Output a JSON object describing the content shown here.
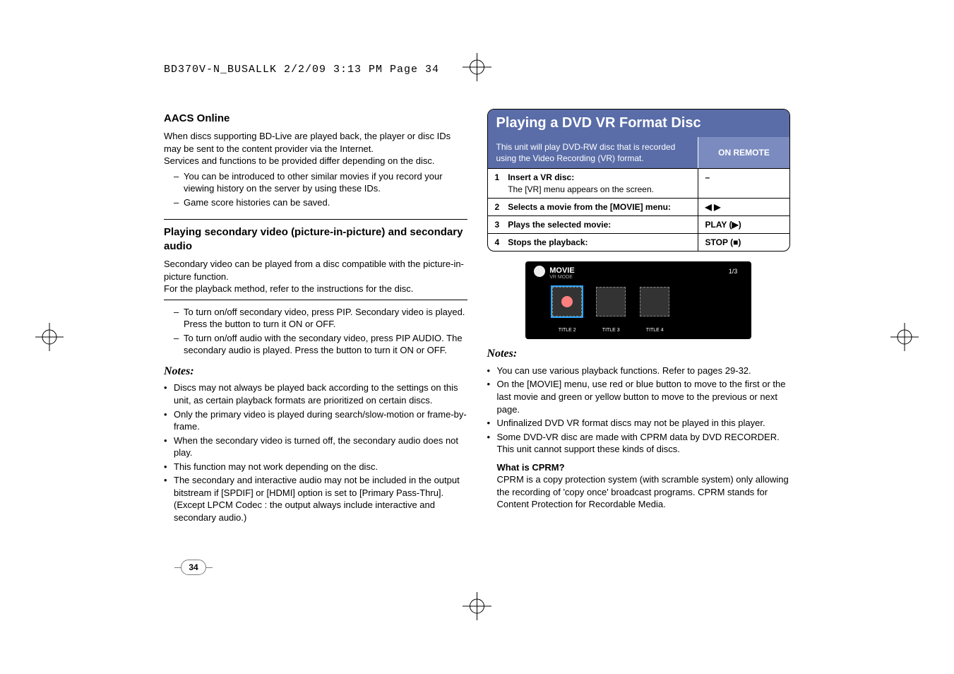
{
  "runhead": "BD370V-N_BUSALLK  2/2/09  3:13 PM  Page 34",
  "page_number": "34",
  "left": {
    "h_aacs": "AACS Online",
    "aacs_p1": "When discs supporting BD-Live are played back, the player or disc IDs may be sent to the content provider via the Internet.",
    "aacs_p2": "Services and functions to be provided differ depending on the disc.",
    "aacs_li1": "You can be introduced to other similar movies if you record your viewing history on the server by using these IDs.",
    "aacs_li2": "Game score histories can be saved.",
    "h_pip": "Playing secondary video (picture-in-picture) and secondary audio",
    "pip_p1": "Secondary video can be played from a disc compatible with the picture-in-picture function.",
    "pip_p2": "For the playback method, refer to the instructions for the disc.",
    "pip_li1": "To turn on/off secondary video, press PIP. Secondary video is played. Press the button to turn it ON or OFF.",
    "pip_li2": "To turn on/off audio with the secondary video, press PIP AUDIO. The secondary audio is played. Press the button to turn it ON or OFF.",
    "notes_h": "Notes:",
    "n1": "Discs may not always be played back according to the settings on this unit, as certain playback formats are prioritized on certain discs.",
    "n2": "Only the primary video is played during search/slow-motion or frame-by-frame.",
    "n3": "When the secondary video is turned off, the secondary audio does not play.",
    "n4": "This function may not work depending on the disc.",
    "n5": "The secondary and interactive audio may not be included in the output bitstream if [SPDIF] or [HDMI] option is set to [Primary Pass-Thru]. (Except LPCM Codec : the output always include interactive and secondary audio.)"
  },
  "right": {
    "panel_title": "Playing a DVD VR Format Disc",
    "panel_sub": "This unit will play DVD-RW disc that is recorded using the Video Recording (VR) format.",
    "panel_sub_right": "ON REMOTE",
    "steps": [
      {
        "idx": "1",
        "label": "Insert a VR disc:",
        "sub": "The [VR] menu appears on the screen.",
        "remote": "–"
      },
      {
        "idx": "2",
        "label": "Selects a movie from the [MOVIE] menu:",
        "sub": "",
        "remote": "◀ ▶"
      },
      {
        "idx": "3",
        "label": "Plays the selected movie:",
        "sub": "",
        "remote": "PLAY (▶)"
      },
      {
        "idx": "4",
        "label": "Stops the playback:",
        "sub": "",
        "remote": "STOP (■)"
      }
    ],
    "shot": {
      "title": "MOVIE",
      "sub": "VR MODE",
      "pager": "1/3",
      "titles": [
        "TITLE 2",
        "TITLE 3",
        "TITLE 4"
      ]
    },
    "notes_h": "Notes:",
    "n1": "You can use various playback functions. Refer to pages 29-32.",
    "n2": "On the [MOVIE] menu, use red or blue button to move to the first or the last movie and green or yellow button to move to the previous or next page.",
    "n3": "Unfinalized DVD VR format discs may not be played in this player.",
    "n4": "Some DVD-VR disc are made with CPRM data by DVD RECORDER. This unit cannot support these kinds of discs.",
    "cprm_h": "What is CPRM?",
    "cprm_p": "CPRM is a copy protection system (with scramble system) only allowing the recording of 'copy once' broadcast programs. CPRM stands for Content Protection for Recordable Media."
  }
}
